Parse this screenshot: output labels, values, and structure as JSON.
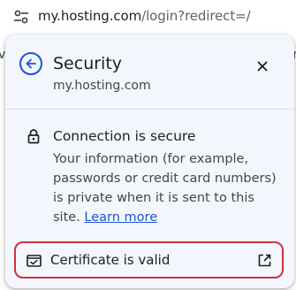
{
  "address_bar": {
    "host": "my.hosting.com",
    "path": "/login?redirect=/"
  },
  "background_page": {
    "left_fragment": "ve",
    "right_fragment": "Fr"
  },
  "popup": {
    "title": "Security",
    "subtitle": "my.hosting.com",
    "connection": {
      "title": "Connection is secure",
      "description": "Your information (for example, passwords or credit card numbers) is private when it is sent to this site.",
      "learn_more": "Learn more"
    },
    "certificate": {
      "label": "Certificate is valid"
    }
  },
  "icons": {
    "tune": "tune-icon",
    "back": "arrow-back-icon",
    "close": "close-icon",
    "lock": "lock-icon",
    "certificate": "certificate-icon",
    "external": "open-in-new-icon"
  },
  "colors": {
    "accent": "#1a55d6",
    "popup_bg": "#f3f6fc",
    "highlight_border": "#d0303a"
  }
}
